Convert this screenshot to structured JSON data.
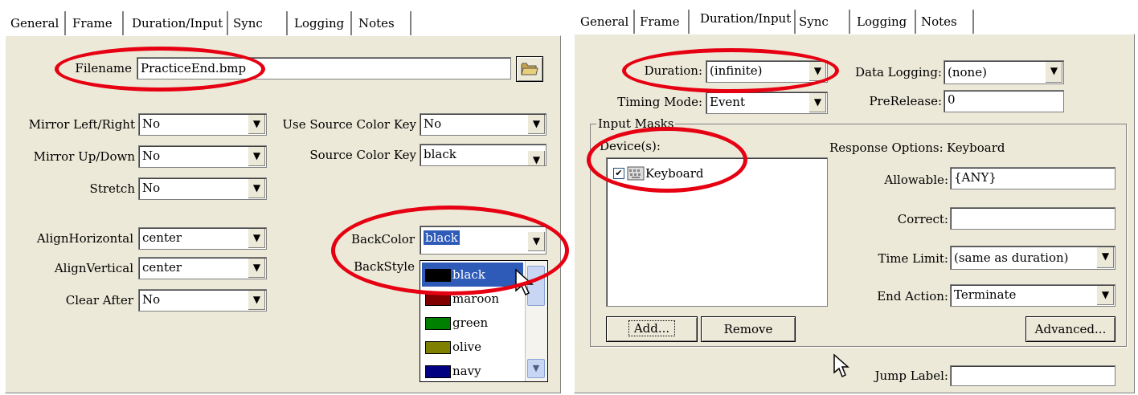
{
  "left": {
    "tabs": [
      "General",
      "Frame",
      "Duration/Input",
      "Sync",
      "Logging",
      "Notes"
    ],
    "filename_label": "Filename",
    "filename_value": "PracticeEnd.bmp",
    "mirror_lr_label": "Mirror Left/Right",
    "mirror_lr_value": "No",
    "mirror_ud_label": "Mirror Up/Down",
    "mirror_ud_value": "No",
    "stretch_label": "Stretch",
    "stretch_value": "No",
    "use_source_label": "Use Source Color Key",
    "use_source_value": "No",
    "source_key_label": "Source Color Key",
    "source_key_value": "black",
    "align_h_label": "AlignHorizontal",
    "align_h_value": "center",
    "align_v_label": "AlignVertical",
    "align_v_value": "center",
    "clear_after_label": "Clear After",
    "clear_after_value": "No",
    "backcolor_label": "BackColor",
    "backcolor_value": "black",
    "backstyle_label": "BackStyle",
    "color_options": [
      {
        "name": "black",
        "color": "#000000"
      },
      {
        "name": "maroon",
        "color": "#800000"
      },
      {
        "name": "green",
        "color": "#008000"
      },
      {
        "name": "olive",
        "color": "#808000"
      },
      {
        "name": "navy",
        "color": "#000080"
      }
    ]
  },
  "right": {
    "tabs": [
      "General",
      "Frame",
      "Duration/Input",
      "Sync",
      "Logging",
      "Notes"
    ],
    "duration_label": "Duration:",
    "duration_value": "(infinite)",
    "timing_label": "Timing Mode:",
    "timing_value": "Event",
    "data_logging_label": "Data Logging:",
    "data_logging_value": "(none)",
    "prerelease_label": "PreRelease:",
    "prerelease_value": "0",
    "input_masks_label": "Input Masks",
    "devices_label": "Device(s):",
    "device_item": "Keyboard",
    "response_options_label": "Response Options:",
    "response_options_value": "Keyboard",
    "allowable_label": "Allowable:",
    "allowable_value": "{ANY}",
    "correct_label": "Correct:",
    "correct_value": "",
    "time_limit_label": "Time Limit:",
    "time_limit_value": "(same as duration)",
    "end_action_label": "End Action:",
    "end_action_value": "Terminate",
    "add_button": "Add...",
    "remove_button": "Remove",
    "advanced_button": "Advanced...",
    "jump_label": "Jump Label:",
    "jump_value": ""
  },
  "accent_color": "#e60012"
}
